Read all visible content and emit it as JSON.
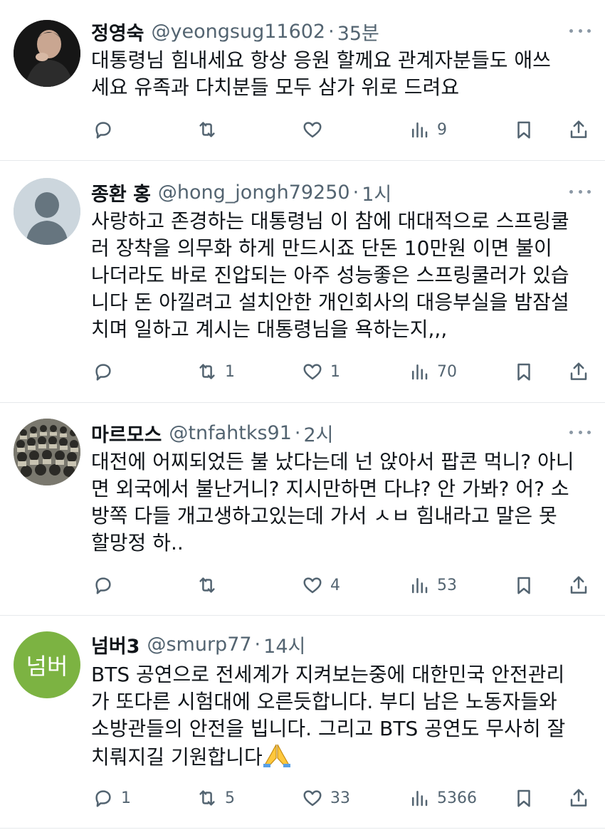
{
  "tweets": [
    {
      "name": "정영숙",
      "handle": "@yeongsug11602",
      "dot": "·",
      "time": "35분",
      "lines": [
        "대통령님  힘내세요 항상 응원 할께요 관계자분들도 애쓰",
        "세요  유족과 다치분들 모두 삼가 위로  드려요"
      ],
      "replies": "",
      "retweets": "",
      "likes": "",
      "views": "9"
    },
    {
      "name": "종환 홍",
      "handle": "@hong_jongh79250",
      "dot": "·",
      "time": "1시",
      "lines": [
        "사랑하고 존경하는 대통령님 이 참에 대대적으로 스프링쿨",
        "러 장착을 의무화 하게 만드시죠 단돈  10만원 이면 불이",
        "나더라도 바로 진압되는 아주 성능좋은 스프링쿨러가 있습",
        "니다 돈 아낄려고 설치안한 개인회사의 대응부실을 밤잠설",
        "치며 일하고 계시는 대통령님을 욕하는지,,,"
      ],
      "replies": "",
      "retweets": "1",
      "likes": "1",
      "views": "70"
    },
    {
      "name": "마르모스",
      "handle": "@tnfahtks91",
      "dot": "·",
      "time": "2시",
      "lines": [
        "대전에 어찌되었든 불 났다는데 넌 앉아서 팝콘 먹니? 아니",
        "면 외국에서 불난거니? 지시만하면 다냐? 안 가봐? 어? 소",
        "방쪽 다들 개고생하고있는데 가서 ㅅㅂ 힘내라고 말은 못",
        "할망정 하.."
      ],
      "replies": "",
      "retweets": "",
      "likes": "4",
      "views": "53"
    },
    {
      "name": "넘버3",
      "handle": "@smurp77",
      "dot": "·",
      "time": "14시",
      "avatar_text": "넘버",
      "lines": [
        "BTS 공연으로 전세계가 지켜보는중에 대한민국 안전관리",
        "가 또다른 시험대에 오른듯합니다. 부디 남은 노동자들와",
        "소방관들의 안전을 빕니다. 그리고 BTS 공연도 무사히 잘",
        "치뤄지길 기원합니다"
      ],
      "replies": "1",
      "retweets": "5",
      "likes": "33",
      "views": "5366"
    }
  ],
  "colors": {
    "text": "#0f1419",
    "muted": "#536471",
    "divider": "#e6e9ec",
    "avatar_green": "#7cb342",
    "avatar_gray": "#ccd6dd"
  },
  "icons": [
    "reply-icon",
    "retweet-icon",
    "like-icon",
    "views-icon",
    "bookmark-icon",
    "share-icon",
    "more-icon",
    "folded-hands-emoji"
  ]
}
